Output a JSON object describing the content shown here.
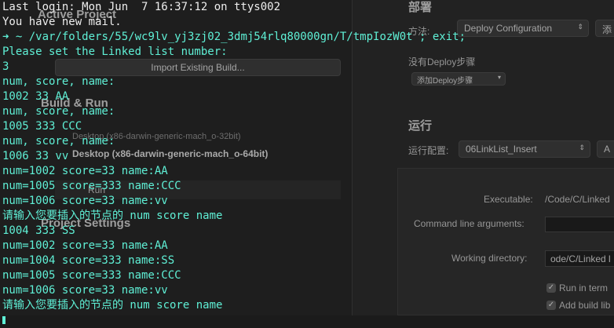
{
  "ide": {
    "active_project": "Active Project",
    "import_button": "Import Existing Build...",
    "build_run": "Build & Run",
    "target_dim": "Desktop (x86-darwin-generic-mach_o-32bit)",
    "target_selected": "Desktop (x86-darwin-generic-mach_o-64bit)",
    "run_row": "Run",
    "project_settings": "Project Settings",
    "deploy_heading": "部署",
    "method_label": "方法:",
    "deploy_config": "Deploy Configuration",
    "add_button": "添",
    "no_deploy_steps": "没有Deploy步骤",
    "add_deploy_step": "添加Deploy步骤",
    "run_heading": "运行",
    "run_config_label": "运行配置:",
    "run_config_value": "06LinkList_Insert",
    "executable_label": "Executable:",
    "executable_value": "/Code/C/Linked",
    "cmd_args_label": "Command line arguments:",
    "workdir_label": "Working directory:",
    "workdir_value": "ode/C/Linked l",
    "run_in_terminal": "Run in term",
    "add_build_lib": "Add build lib"
  },
  "terminal": {
    "lines": [
      "Last login: Mon Jun  7 16:37:12 on ttys002",
      "You have new mail.",
      "Please set the Linked list number:",
      "3",
      "num, score, name:",
      "1002 33 AA",
      "num, score, name:",
      "1005 333 CCC",
      "num, score, name:",
      "1006 33 vv",
      "num=1002 score=33 name:AA",
      "num=1005 score=333 name:CCC",
      "num=1006 score=33 name:vv",
      "请输入您要插入的节点的 num score name",
      "1004 333 SS",
      "num=1002 score=33 name:AA",
      "num=1004 score=333 name:SS",
      "num=1005 score=333 name:CCC",
      "num=1006 score=33 name:vv",
      "请输入您要插入的节点的 num score name"
    ],
    "prompt_symbol": "➜",
    "prompt_command": " ~ /var/folders/55/wc9lv_yj3zj02_3dmj54rlq80000gn/T/tmpIozW0t ; exit;"
  },
  "colors": {
    "terminal_text": "#5ff0d6",
    "background": "#1b1b1b"
  }
}
